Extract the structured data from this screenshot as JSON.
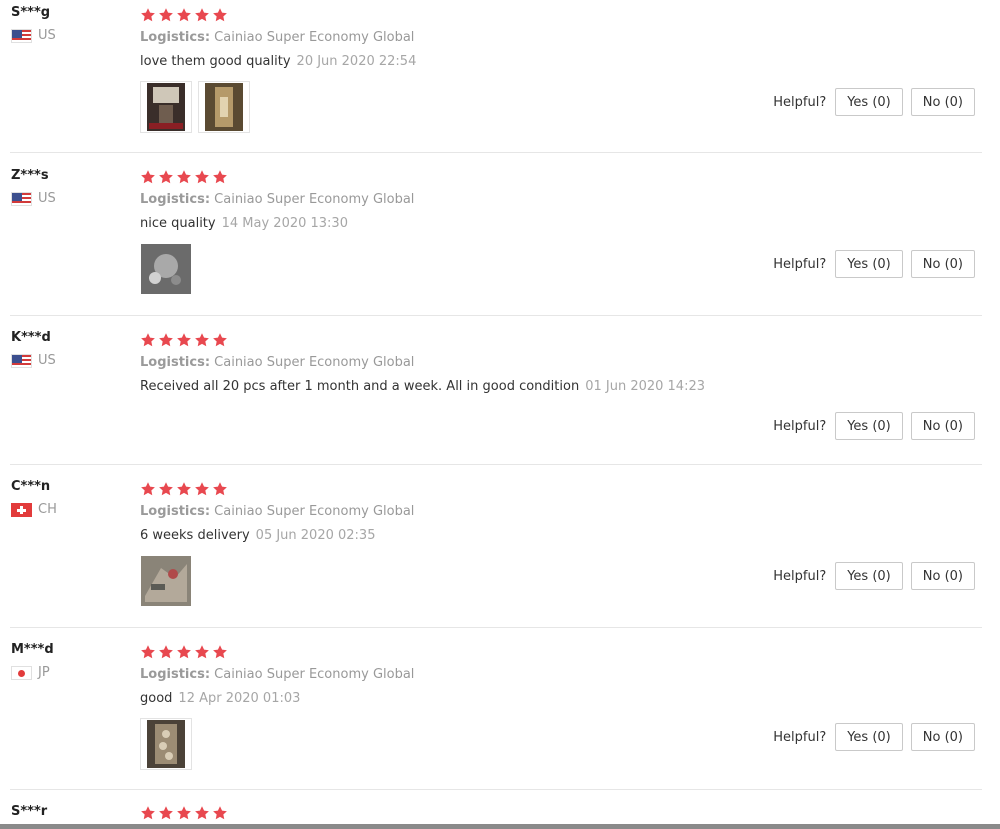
{
  "colors": {
    "star": "#e8484f",
    "divider": "#e6e6e6",
    "muted_text": "#999999"
  },
  "helpful_label": "Helpful?",
  "reviews": [
    {
      "user": "S***g",
      "country": "US",
      "flag_icon": "us-flag-icon",
      "stars": 5,
      "logistics_label": "Logistics:",
      "logistics_value": " Cainiao Super Economy Global",
      "text": "love them good quality",
      "date": "20 Jun 2020 22:54",
      "photos": [
        "photo-thumbnail-1",
        "photo-thumbnail-2"
      ],
      "yes_label": "Yes (0)",
      "no_label": "No (0)"
    },
    {
      "user": "Z***s",
      "country": "US",
      "flag_icon": "us-flag-icon",
      "stars": 5,
      "logistics_label": "Logistics:",
      "logistics_value": " Cainiao Super Economy Global",
      "text": "nice quality",
      "date": "14 May 2020 13:30",
      "photos": [
        "photo-thumbnail-1"
      ],
      "yes_label": "Yes (0)",
      "no_label": "No (0)"
    },
    {
      "user": "K***d",
      "country": "US",
      "flag_icon": "us-flag-icon",
      "stars": 5,
      "logistics_label": "Logistics:",
      "logistics_value": " Cainiao Super Economy Global",
      "text": "Received all 20 pcs after 1 month and a week. All in good condition",
      "date": "01 Jun 2020 14:23",
      "photos": [],
      "yes_label": "Yes (0)",
      "no_label": "No (0)"
    },
    {
      "user": "C***n",
      "country": "CH",
      "flag_icon": "ch-flag-icon",
      "stars": 5,
      "logistics_label": "Logistics:",
      "logistics_value": " Cainiao Super Economy Global",
      "text": "6 weeks delivery",
      "date": "05 Jun 2020 02:35",
      "photos": [
        "photo-thumbnail-1"
      ],
      "yes_label": "Yes (0)",
      "no_label": "No (0)"
    },
    {
      "user": "M***d",
      "country": "JP",
      "flag_icon": "jp-flag-icon",
      "stars": 5,
      "logistics_label": "Logistics:",
      "logistics_value": " Cainiao Super Economy Global",
      "text": "good",
      "date": "12 Apr 2020 01:03",
      "photos": [
        "photo-thumbnail-1"
      ],
      "yes_label": "Yes (0)",
      "no_label": "No (0)"
    },
    {
      "user": "S***r",
      "stars": 5
    }
  ]
}
